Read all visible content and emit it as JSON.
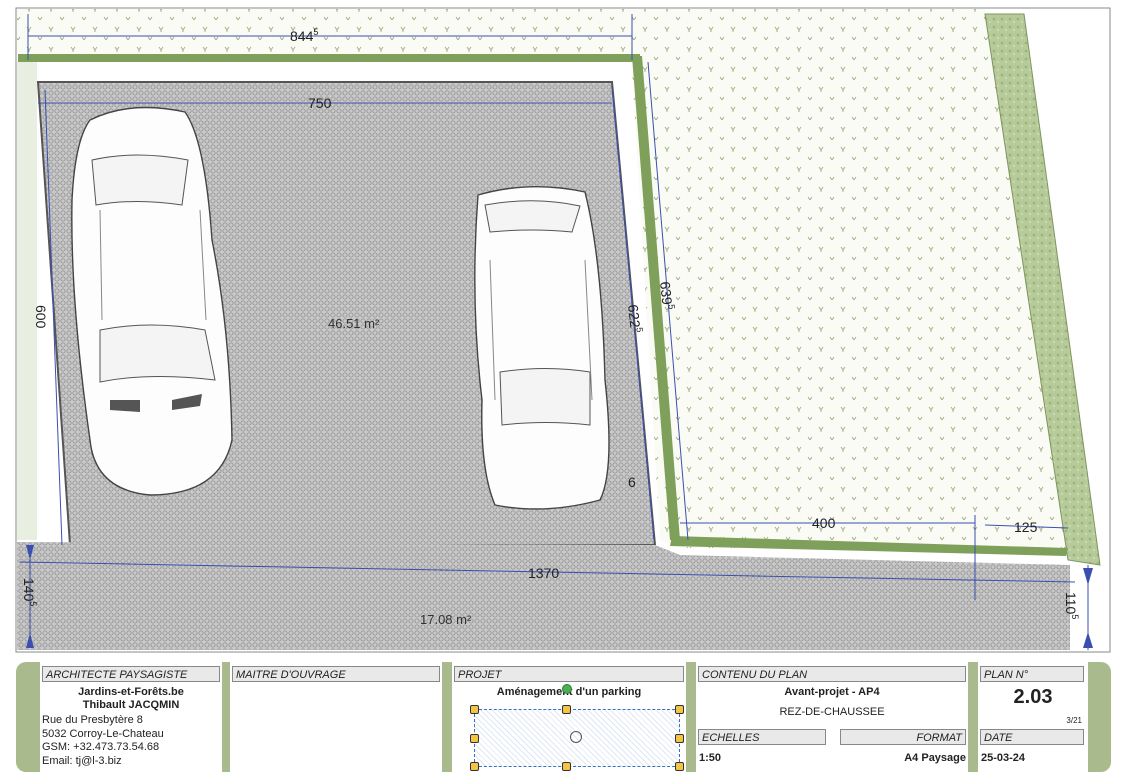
{
  "plan": {
    "dimensions": {
      "top_width": "844",
      "top_width_sup": "5",
      "parking_width": "750",
      "left_height": "600",
      "inner_right": "622",
      "inner_right_sup": "5",
      "outer_right": "639",
      "outer_right_sup": "5",
      "small_offset": "6",
      "lawn_bottom": "400",
      "hedge_width": "125",
      "total_width": "1370",
      "left_strip": "140",
      "left_strip_sup": "5",
      "right_strip": "110",
      "right_strip_sup": "5"
    },
    "areas": {
      "parking": "46.51 m²",
      "strip": "17.08 m²"
    },
    "colors": {
      "paving": "#c6c6c6",
      "lawn": "#fbfbf6",
      "hedge": "#b6c999",
      "dimension_line": "#3a4fb0",
      "frame_green": "#a9bb8c"
    }
  },
  "title_block": {
    "architect": {
      "header": "ARCHITECTE PAYSAGISTE",
      "company": "Jardins-et-Forêts.be",
      "name": "Thibault JACQMIN",
      "address1": "Rue du Presbytère 8",
      "address2": "5032 Corroy-Le-Chateau",
      "gsm": "GSM: +32.473.73.54.68",
      "email": "Email: tj@l-3.biz"
    },
    "owner": {
      "header": "MAITRE D'OUVRAGE"
    },
    "project": {
      "header": "PROJET",
      "title": "Aménagement d'un parking"
    },
    "content": {
      "header": "CONTENU DU PLAN",
      "title": "Avant-projet - AP4",
      "subtitle": "REZ-DE-CHAUSSEE",
      "scale_header": "ECHELLES",
      "scale_value": "1:50",
      "format_header": "FORMAT",
      "format_value": "A4 Paysage"
    },
    "plan_no": {
      "header": "PLAN N°",
      "value": "2.03",
      "page": "3/21"
    },
    "date": {
      "header": "DATE",
      "value": "25-03-24"
    }
  }
}
